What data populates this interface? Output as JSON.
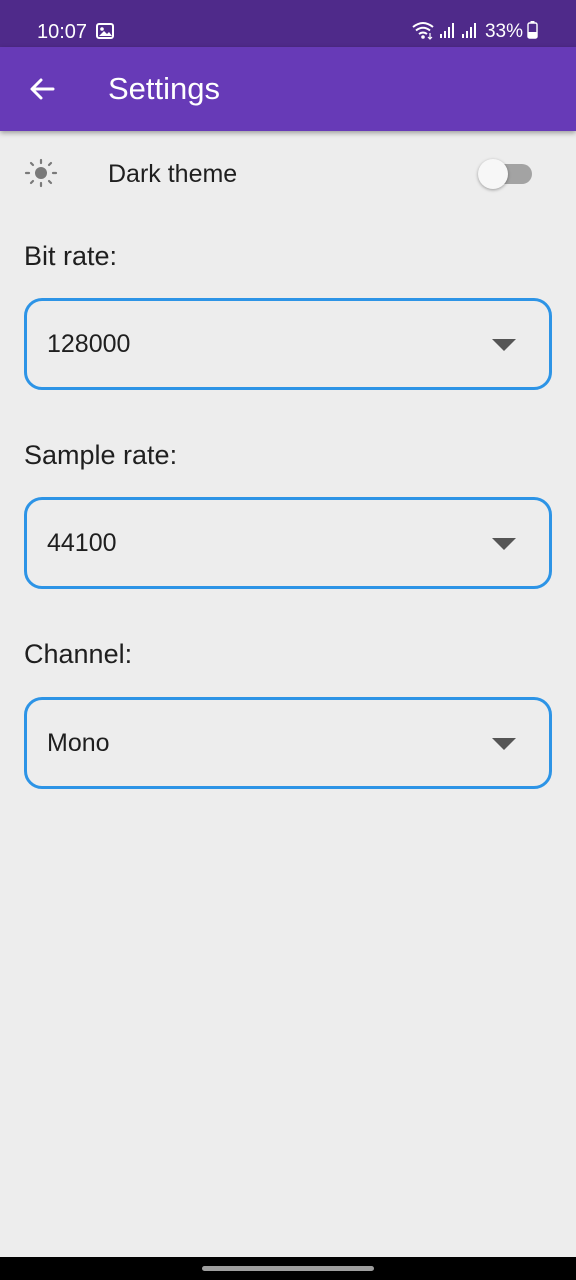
{
  "status_bar": {
    "time": "10:07",
    "battery": "33%",
    "icons": [
      "gallery-icon",
      "wifi-icon",
      "signal-icon",
      "signal-icon",
      "battery-icon"
    ]
  },
  "app_bar": {
    "title": "Settings",
    "back_icon": "arrow-back-icon",
    "color": "#673ab7"
  },
  "theme": {
    "label": "Dark theme",
    "icon": "sun-icon",
    "enabled": false
  },
  "fields": {
    "bit_rate": {
      "label": "Bit rate:",
      "value": "128000"
    },
    "sample_rate": {
      "label": "Sample rate:",
      "value": "44100"
    },
    "channel": {
      "label": "Channel:",
      "value": "Mono"
    }
  },
  "colors": {
    "accent": "#2d94e6",
    "status_bar": "#4f2a8a",
    "background": "#ededed"
  }
}
